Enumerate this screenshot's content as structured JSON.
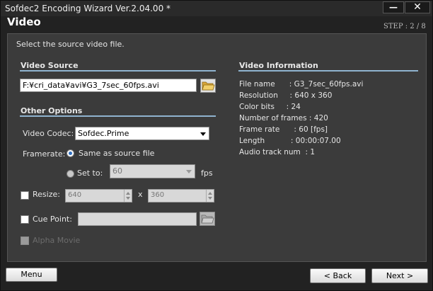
{
  "window": {
    "title": "Sofdec2 Encoding Wizard Ver.2.04.00 *",
    "minimize_glyph": "—",
    "close_glyph": "✕"
  },
  "header": {
    "page_title": "Video",
    "step": "STEP : 2 / 8"
  },
  "instruction": "Select the source video file.",
  "video_source": {
    "section_title": "Video Source",
    "path": "F:¥cri_data¥avi¥G3_7sec_60fps.avi",
    "browse_icon": "folder-open-icon"
  },
  "other_options": {
    "section_title": "Other Options",
    "video_codec_label": "Video Codec:",
    "video_codec_value": "Sofdec.Prime",
    "framerate_label": "Framerate:",
    "same_as_source_label": "Same as source file",
    "set_to_label": "Set to:",
    "set_to_value": "60",
    "fps_label": "fps",
    "resize_label": "Resize:",
    "resize_width": "640",
    "resize_x": "x",
    "resize_height": "360",
    "cue_point_label": "Cue Point:",
    "cue_point_value": "",
    "alpha_movie_label": "Alpha Movie"
  },
  "video_information": {
    "section_title": "Video Information",
    "rows": [
      "File name      : G3_7sec_60fps.avi",
      "Resolution     : 640 x 360",
      "Color bits     : 24",
      "Number of frames : 420",
      "Frame rate      : 60 [fps]",
      "Length           : 00:00:07.00",
      "Audio track num  : 1"
    ]
  },
  "footer": {
    "menu_label": "Menu",
    "back_label": "< Back",
    "next_label": "Next >"
  }
}
